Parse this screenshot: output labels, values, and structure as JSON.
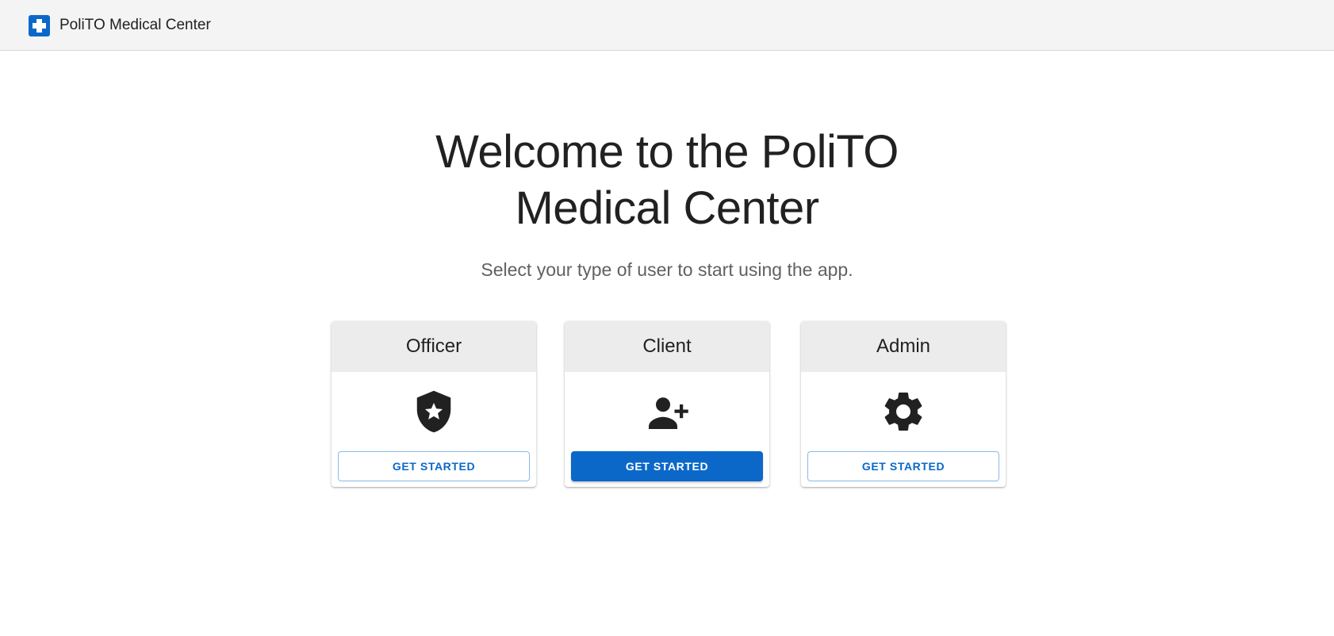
{
  "app": {
    "title": "PoliTO Medical Center",
    "brand_icon": "medical-cross-icon",
    "accent_color": "#0b68c9"
  },
  "hero": {
    "title_line1": "Welcome to the PoliTO",
    "title_line2": "Medical Center",
    "subtitle": "Select your type of user to start using the app."
  },
  "cards": [
    {
      "title": "Officer",
      "icon": "shield-star-icon",
      "button_label": "GET STARTED",
      "button_style": "outlined"
    },
    {
      "title": "Client",
      "icon": "person-add-icon",
      "button_label": "GET STARTED",
      "button_style": "contained"
    },
    {
      "title": "Admin",
      "icon": "gear-icon",
      "button_label": "GET STARTED",
      "button_style": "outlined"
    }
  ]
}
